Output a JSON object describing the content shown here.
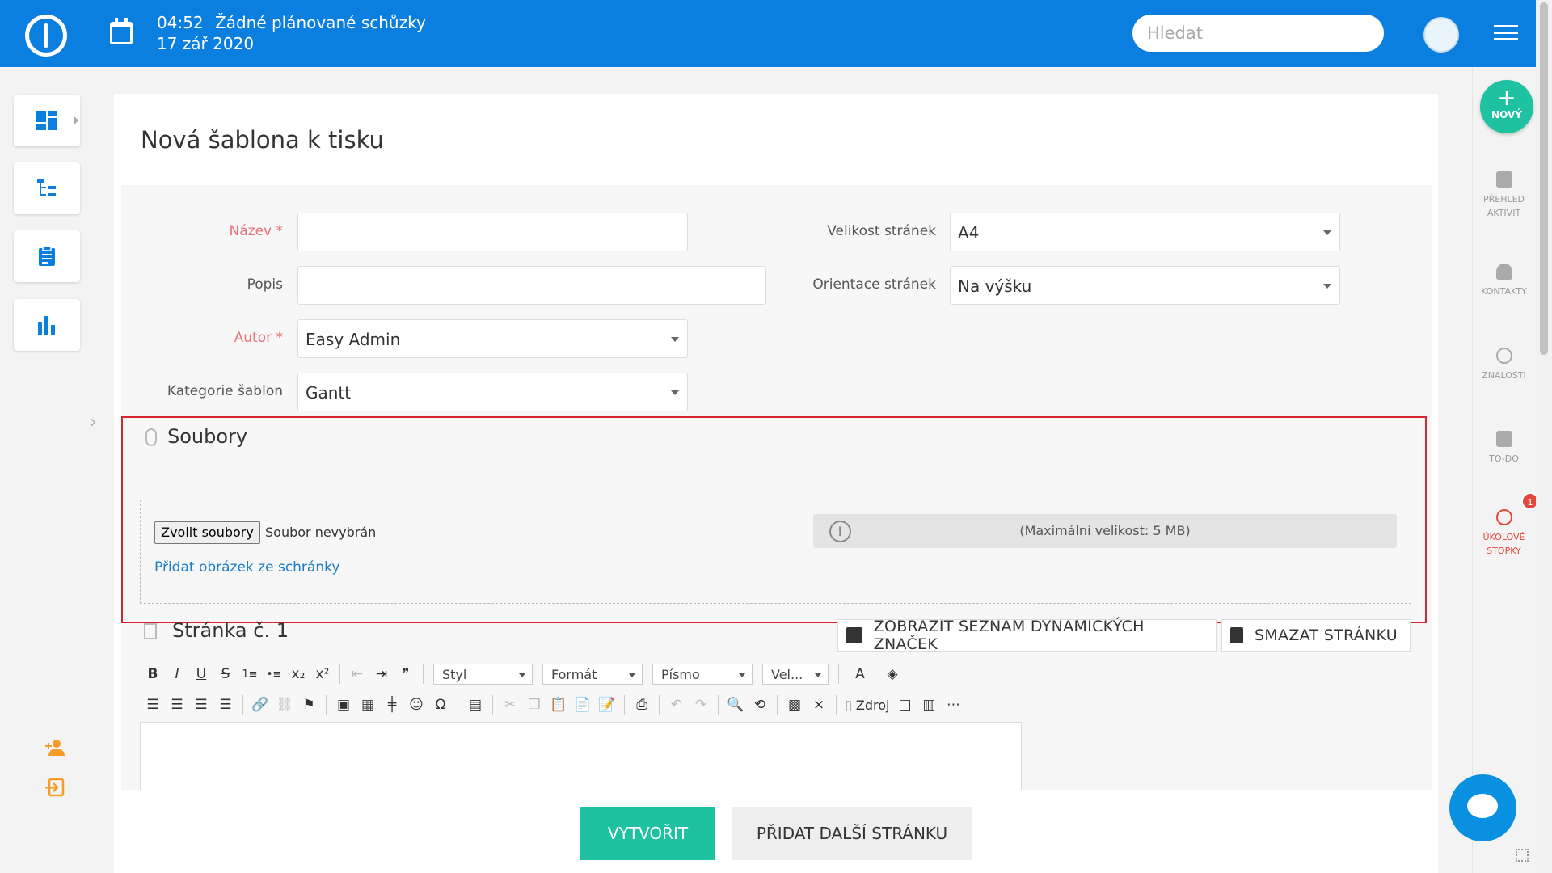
{
  "topbar": {
    "time": "04:52",
    "meetings": "Žádné plánované schůzky",
    "date": "17 zář 2020",
    "search_placeholder": "Hledat"
  },
  "page": {
    "title": "Nová šablona k tisku"
  },
  "form": {
    "name_label": "Název *",
    "description_label": "Popis",
    "author_label": "Autor *",
    "author_value": "Easy Admin",
    "category_label": "Kategorie šablon",
    "category_value": "Gantt",
    "page_size_label": "Velikost stránek",
    "page_size_value": "A4",
    "orientation_label": "Orientace stránek",
    "orientation_value": "Na výšku"
  },
  "files": {
    "title": "Soubory",
    "choose_button": "Zvolit soubory",
    "no_file": "Soubor nevybrán",
    "clipboard_link": "Přidat obrázek ze schránky",
    "max_size": "(Maximální velikost: 5 MB)"
  },
  "pagesection": {
    "title": "Stránka č. 1",
    "show_tags_button": "ZOBRAZIT SEZNAM DYNAMICKÝCH ZNAČEK",
    "delete_page_button": "SMAZAT STRÁNKU"
  },
  "toolbar": {
    "bold": "B",
    "italic": "I",
    "underline": "U",
    "strike": "S",
    "numbered": "1≡",
    "bullets": "•≡",
    "subscript": "x₂",
    "superscript": "x²",
    "outdent": "⇤",
    "indent": "⇥",
    "quote": "❞",
    "style": "Styl",
    "format": "Formát",
    "font": "Písmo",
    "size": "Vel...",
    "text_color": "A",
    "bg_color": "◈",
    "align_left": "☰",
    "align_center": "☰",
    "align_right": "☰",
    "justify": "☰",
    "link": "🔗",
    "unlink": "⛓",
    "anchor": "⚑",
    "image": "▣",
    "table": "▦",
    "hr": "╪",
    "smiley": "☺",
    "special_char": "Ω",
    "iframe": "▤",
    "cut": "✂",
    "copy": "❐",
    "paste": "📋",
    "paste_text": "📄",
    "paste_word": "📝",
    "print": "⎙",
    "undo": "↶",
    "redo": "↷",
    "find": "🔍",
    "replace": "⟲",
    "select_all": "▩",
    "remove_format": "⨯",
    "source_label": "Zdroj",
    "preview": "◫",
    "templates": "▥",
    "page_break": "⋯"
  },
  "actions": {
    "create": "VYTVOŘIT",
    "add_page": "PŘIDAT DALŠÍ STRÁNKU"
  },
  "rightbar": {
    "new_plus": "+",
    "new_label": "NOVÝ",
    "activity_1": "PŘEHLED",
    "activity_2": "AKTIVIT",
    "contacts": "KONTAKTY",
    "knowledge": "ZNALOSTI",
    "todo": "TO-DO",
    "timers_1": "ÚKOLOVÉ",
    "timers_2": "STOPKY",
    "timers_badge": "1"
  },
  "colors": {
    "topbar": "#0a7fe0",
    "accent_green": "#1ec1a0",
    "required_label": "#e5737a",
    "highlight_border": "#d9232e",
    "link": "#1a7bc8"
  }
}
